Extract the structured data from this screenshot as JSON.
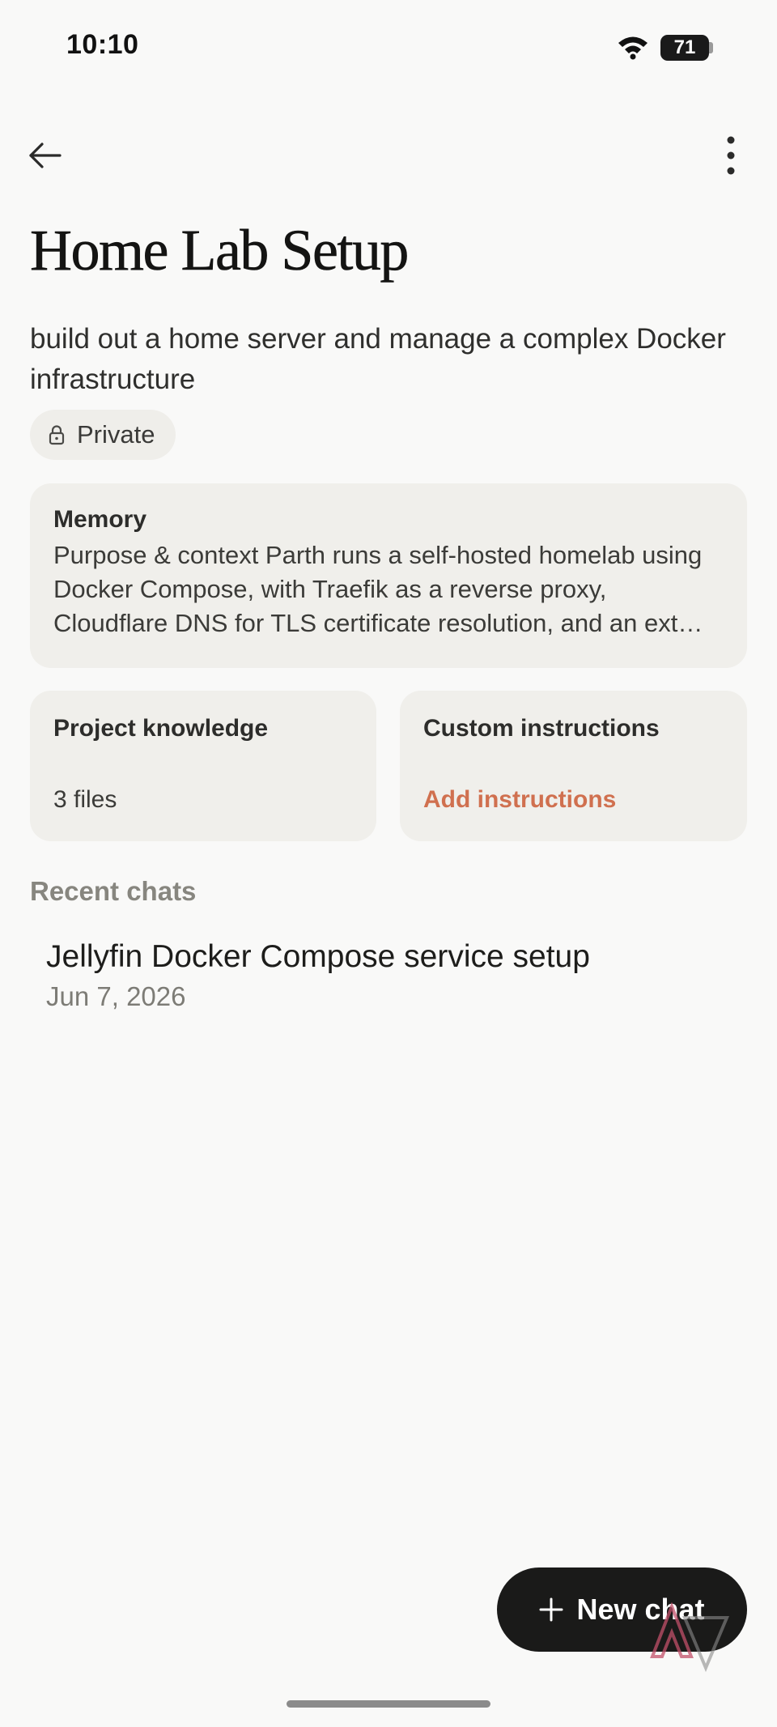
{
  "status_bar": {
    "time": "10:10",
    "battery_level": "71"
  },
  "header": {
    "back_icon": "arrow-left-icon",
    "menu_icon": "more-vertical-icon"
  },
  "project": {
    "title": "Home Lab Setup",
    "description": "build out a home server and manage a complex Docker infrastructure",
    "visibility_label": "Private",
    "visibility_icon": "lock-icon"
  },
  "memory": {
    "heading": "Memory",
    "body": "Purpose & context Parth runs a self-hosted homelab using Docker Compose, with Traefik as a reverse proxy, Cloudflare DNS for TLS certificate resolution, and an ext…"
  },
  "knowledge": {
    "heading": "Project knowledge",
    "files_label": "3 files"
  },
  "instructions": {
    "heading": "Custom instructions",
    "action_label": "Add instructions",
    "action_color": "#d0704f"
  },
  "recent_chats": {
    "heading": "Recent chats",
    "items": [
      {
        "title": "Jellyfin Docker Compose service setup",
        "date": "Jun 7, 2026"
      }
    ]
  },
  "fab": {
    "label": "New chat",
    "icon": "plus-icon"
  }
}
